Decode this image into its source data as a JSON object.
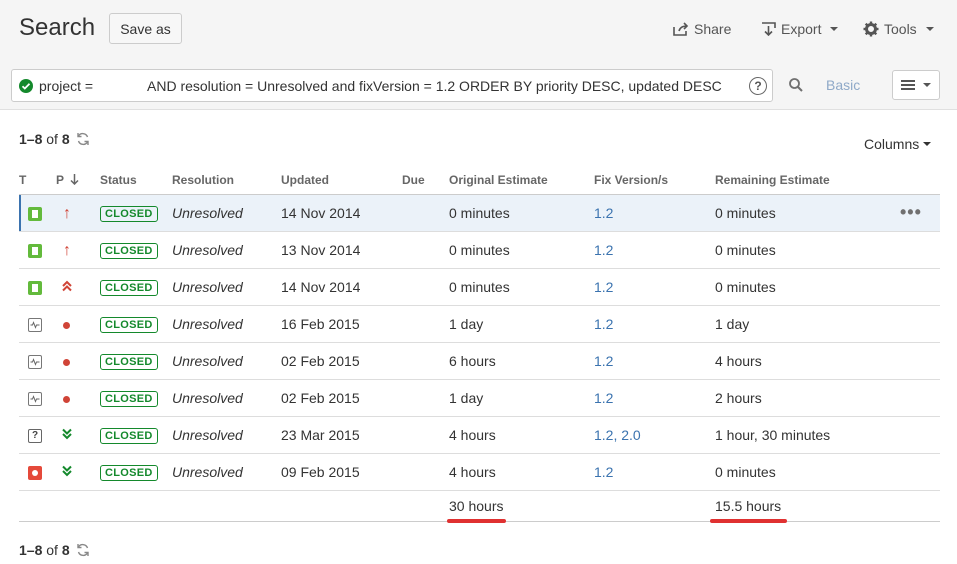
{
  "header": {
    "title": "Search",
    "save_as_label": "Save as",
    "share_label": "Share",
    "export_label": "Export",
    "tools_label": "Tools"
  },
  "query": {
    "prefix": "project =",
    "text": "AND resolution = Unresolved and fixVersion = 1.2 ORDER BY priority DESC, updated DESC",
    "help_icon": "?",
    "basic_label": "Basic"
  },
  "pagination": {
    "range": "1–8",
    "of_label": "of",
    "total": "8"
  },
  "columns_label": "Columns",
  "table": {
    "headers": [
      "T",
      "P",
      "Status",
      "Resolution",
      "Updated",
      "Due",
      "Original Estimate",
      "Fix Version/s",
      "Remaining Estimate"
    ],
    "rows": [
      {
        "type": "story",
        "priority": "highest",
        "status": "CLOSED",
        "resolution": "Unresolved",
        "updated": "14 Nov 2014",
        "due": "",
        "original": "0 minutes",
        "fix": "1.2",
        "remaining": "0 minutes"
      },
      {
        "type": "story",
        "priority": "highest",
        "status": "CLOSED",
        "resolution": "Unresolved",
        "updated": "13 Nov 2014",
        "due": "",
        "original": "0 minutes",
        "fix": "1.2",
        "remaining": "0 minutes"
      },
      {
        "type": "story",
        "priority": "critical",
        "status": "CLOSED",
        "resolution": "Unresolved",
        "updated": "14 Nov 2014",
        "due": "",
        "original": "0 minutes",
        "fix": "1.2",
        "remaining": "0 minutes"
      },
      {
        "type": "task",
        "priority": "major",
        "status": "CLOSED",
        "resolution": "Unresolved",
        "updated": "16 Feb 2015",
        "due": "",
        "original": "1 day",
        "fix": "1.2",
        "remaining": "1 day"
      },
      {
        "type": "task",
        "priority": "major",
        "status": "CLOSED",
        "resolution": "Unresolved",
        "updated": "02 Feb 2015",
        "due": "",
        "original": "6 hours",
        "fix": "1.2",
        "remaining": "4 hours"
      },
      {
        "type": "task",
        "priority": "major",
        "status": "CLOSED",
        "resolution": "Unresolved",
        "updated": "02 Feb 2015",
        "due": "",
        "original": "1 day",
        "fix": "1.2",
        "remaining": "2 hours"
      },
      {
        "type": "question",
        "priority": "trivial",
        "status": "CLOSED",
        "resolution": "Unresolved",
        "updated": "23 Mar 2015",
        "due": "",
        "original": "4 hours",
        "fix": "1.2, 2.0",
        "remaining": "1 hour, 30 minutes"
      },
      {
        "type": "bug",
        "priority": "trivial",
        "status": "CLOSED",
        "resolution": "Unresolved",
        "updated": "09 Feb 2015",
        "due": "",
        "original": "4 hours",
        "fix": "1.2",
        "remaining": "0 minutes"
      }
    ],
    "totals": {
      "original": "30 hours",
      "remaining": "15.5 hours"
    }
  },
  "colors": {
    "accent": "#3b73af",
    "status_closed": "#14892c",
    "priority_high": "#d04437",
    "highlight_underline": "#e03131"
  }
}
